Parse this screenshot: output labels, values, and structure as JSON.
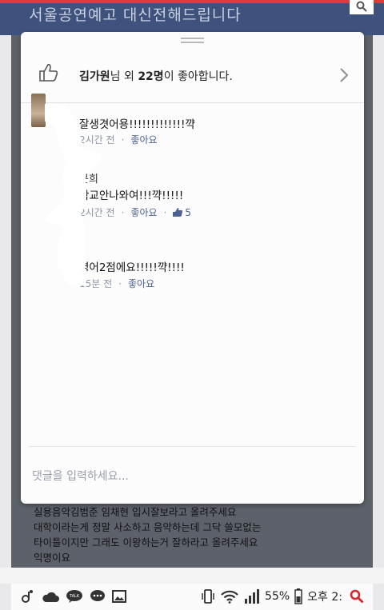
{
  "header": {
    "title": "서울공연예고 대신전해드립니다"
  },
  "likes": {
    "name": "김가원",
    "suffix1": "님 외 ",
    "count": "22명",
    "suffix2": "이 좋아합니다."
  },
  "comments": [
    {
      "name": "",
      "text": "잘생겻어용!!!!!!!!!!!!!꺅",
      "time": "2시간 전",
      "like_label": "좋아요",
      "like_count": ""
    },
    {
      "name": "문희",
      "text": "학교안나와여!!!꺅!!!!!",
      "time": "2시간 전",
      "like_label": "좋아요",
      "like_count": "5"
    },
    {
      "name": "",
      "text": "영어2점에요!!!!!꺅!!!!",
      "time": "15분 전",
      "like_label": "좋아요",
      "like_count": ""
    }
  ],
  "comment_input": {
    "placeholder": "댓글을 입력하세요..."
  },
  "post_text": [
    "실용음악김범준 임채현 입시잘보라고 올려주세요",
    "대학이라는게 정말 사소하고 음악하는데 그닥 쓸모없는",
    "타이틀이지만 그래도 이왕하는거 잘하라고 올려주세요",
    "익명이요"
  ],
  "status_bar": {
    "battery": "55%",
    "time": "오후 2:"
  },
  "colors": {
    "header": "#3e527d",
    "accent_red": "#e23a3a",
    "link": "#4b6391"
  }
}
